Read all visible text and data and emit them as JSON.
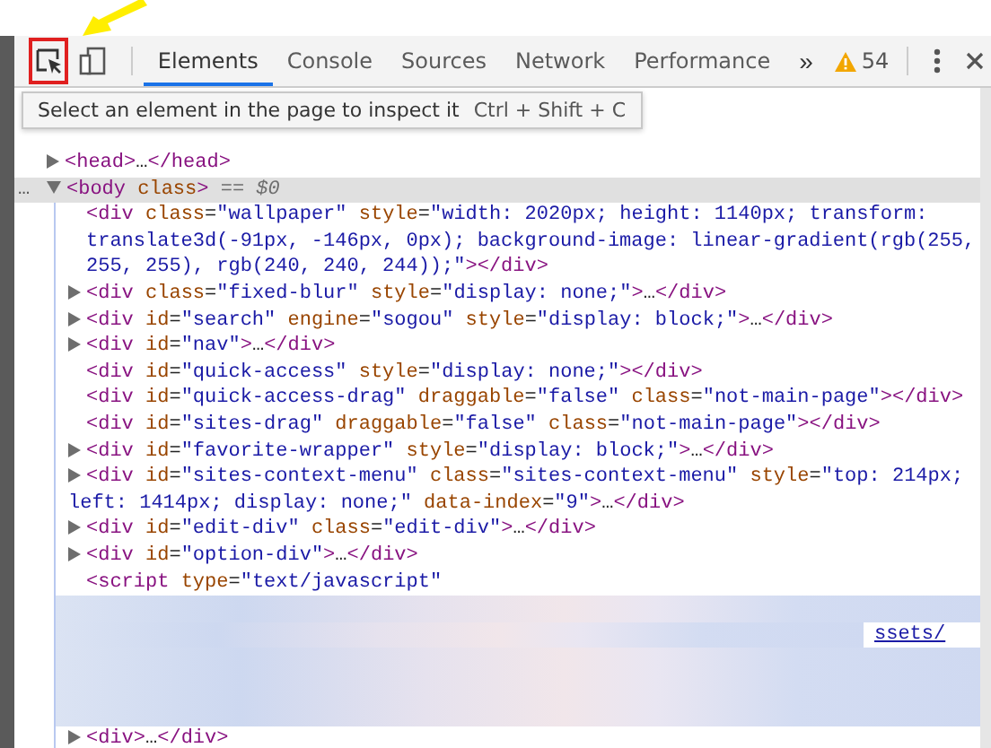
{
  "toolbar": {
    "tabs": [
      {
        "label": "Elements",
        "selected": true
      },
      {
        "label": "Console",
        "selected": false
      },
      {
        "label": "Sources",
        "selected": false
      },
      {
        "label": "Network",
        "selected": false
      },
      {
        "label": "Performance",
        "selected": false
      }
    ],
    "more": "»",
    "warnings": "54",
    "inspect_active": true
  },
  "tooltip": {
    "text": "Select an element in the page to inspect it",
    "shortcut": "Ctrl + Shift + C"
  },
  "dom": [
    {
      "text": "<head>…</head>",
      "expanded": false
    },
    {
      "text": "<body class>",
      "expanded": true,
      "selected": true,
      "dots": "…",
      "marker": "== $0",
      "children": [
        {
          "text": "<div class=\"wallpaper\" style=\"width: 2020px; height: 1140px; transform: translate3d(-91px, -146px, 0px); background-image: linear-gradient(rgb(255, 255, 255), rgb(240, 240, 244));\"></div>"
        },
        {
          "text": "<div class=\"fixed-blur\" style=\"display: none;\">…</div>",
          "expanded": false
        },
        {
          "text": "<div id=\"search\" engine=\"sogou\" style=\"display: block;\">…</div>",
          "expanded": false
        },
        {
          "text": "<div id=\"nav\">…</div>",
          "expanded": false
        },
        {
          "text": "<div id=\"quick-access\" style=\"display: none;\"></div>"
        },
        {
          "text": "<div id=\"quick-access-drag\" draggable=\"false\" class=\"not-main-page\"></div>"
        },
        {
          "text": "<div id=\"sites-drag\" draggable=\"false\" class=\"not-main-page\"></div>"
        },
        {
          "text": "<div id=\"favorite-wrapper\" style=\"display: block;\">…</div>",
          "expanded": false
        },
        {
          "text": "<div id=\"sites-context-menu\" class=\"sites-context-menu\" style=\"top: 214px; left: 1414px; display: none;\" data-index=\"9\">…</div>",
          "expanded": false
        },
        {
          "text": "<div id=\"edit-div\" class=\"edit-div\">…</div>",
          "expanded": false
        },
        {
          "text": "<div id=\"option-div\">…</div>",
          "expanded": false
        },
        {
          "text": "<script type=\"text/javascript\"",
          "blurred_lines": [
            {
              "kind": "blur"
            },
            {
              "kind": "blur-link",
              "link": "ssets/"
            },
            {
              "kind": "blur"
            },
            {
              "kind": "blur"
            },
            {
              "kind": "blur"
            }
          ]
        },
        {
          "text": "<div>…</div>",
          "expanded": false
        }
      ]
    }
  ]
}
